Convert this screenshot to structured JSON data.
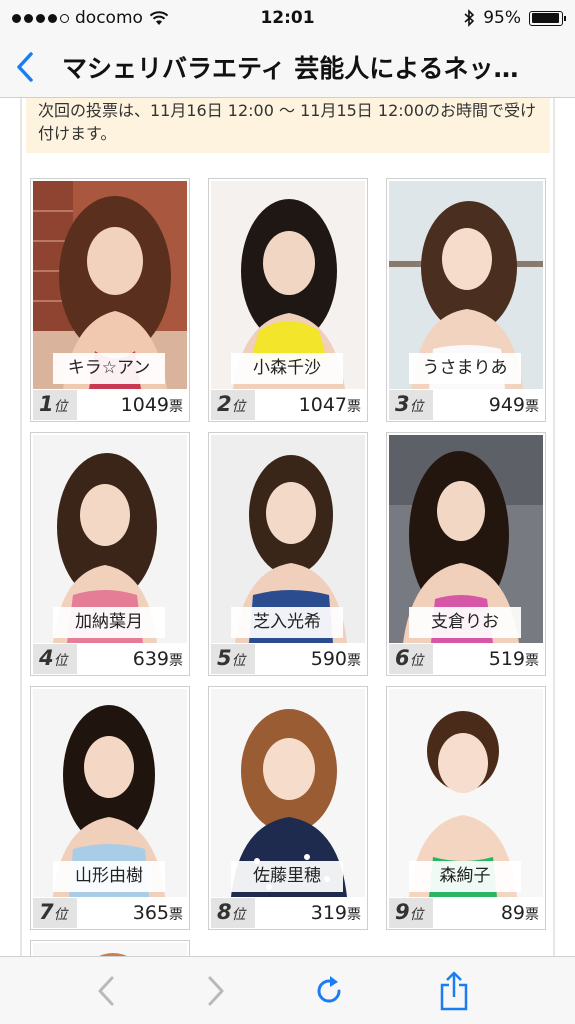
{
  "status": {
    "carrier": "docomo",
    "time": "12:01",
    "battery": "95%",
    "battery_level": 0.95
  },
  "nav": {
    "title": "マシェリバラエティ 芸能人によるネッ…"
  },
  "notice": {
    "text": "次回の投票は、11月16日 12:00 〜 11月15日 12:00のお時間で受け付けます。"
  },
  "ranking": [
    {
      "name": "キラ☆アン",
      "rank": "1",
      "rank_suffix": "位",
      "votes": "1049",
      "votes_suffix": "票"
    },
    {
      "name": "小森千沙",
      "rank": "2",
      "rank_suffix": "位",
      "votes": "1047",
      "votes_suffix": "票"
    },
    {
      "name": "うさまりあ",
      "rank": "3",
      "rank_suffix": "位",
      "votes": "949",
      "votes_suffix": "票"
    },
    {
      "name": "加納葉月",
      "rank": "4",
      "rank_suffix": "位",
      "votes": "639",
      "votes_suffix": "票"
    },
    {
      "name": "芝入光希",
      "rank": "5",
      "rank_suffix": "位",
      "votes": "590",
      "votes_suffix": "票"
    },
    {
      "name": "支倉りお",
      "rank": "6",
      "rank_suffix": "位",
      "votes": "519",
      "votes_suffix": "票"
    },
    {
      "name": "山形由樹",
      "rank": "7",
      "rank_suffix": "位",
      "votes": "365",
      "votes_suffix": "票"
    },
    {
      "name": "佐藤里穂",
      "rank": "8",
      "rank_suffix": "位",
      "votes": "319",
      "votes_suffix": "票"
    },
    {
      "name": "森絢子",
      "rank": "9",
      "rank_suffix": "位",
      "votes": "89",
      "votes_suffix": "票"
    }
  ],
  "colors": {
    "accent": "#1a7ef2",
    "notice_bg": "#fdf3de",
    "rank_bg": "#e3e3e3",
    "disabled": "#b9b9b9"
  },
  "icons": {
    "back": "chevron-left-icon",
    "wifi": "wifi-icon",
    "bluetooth": "bluetooth-icon",
    "battery": "battery-icon",
    "browser_back": "chevron-left-icon",
    "browser_forward": "chevron-right-icon",
    "reload": "reload-icon",
    "share": "share-icon"
  }
}
